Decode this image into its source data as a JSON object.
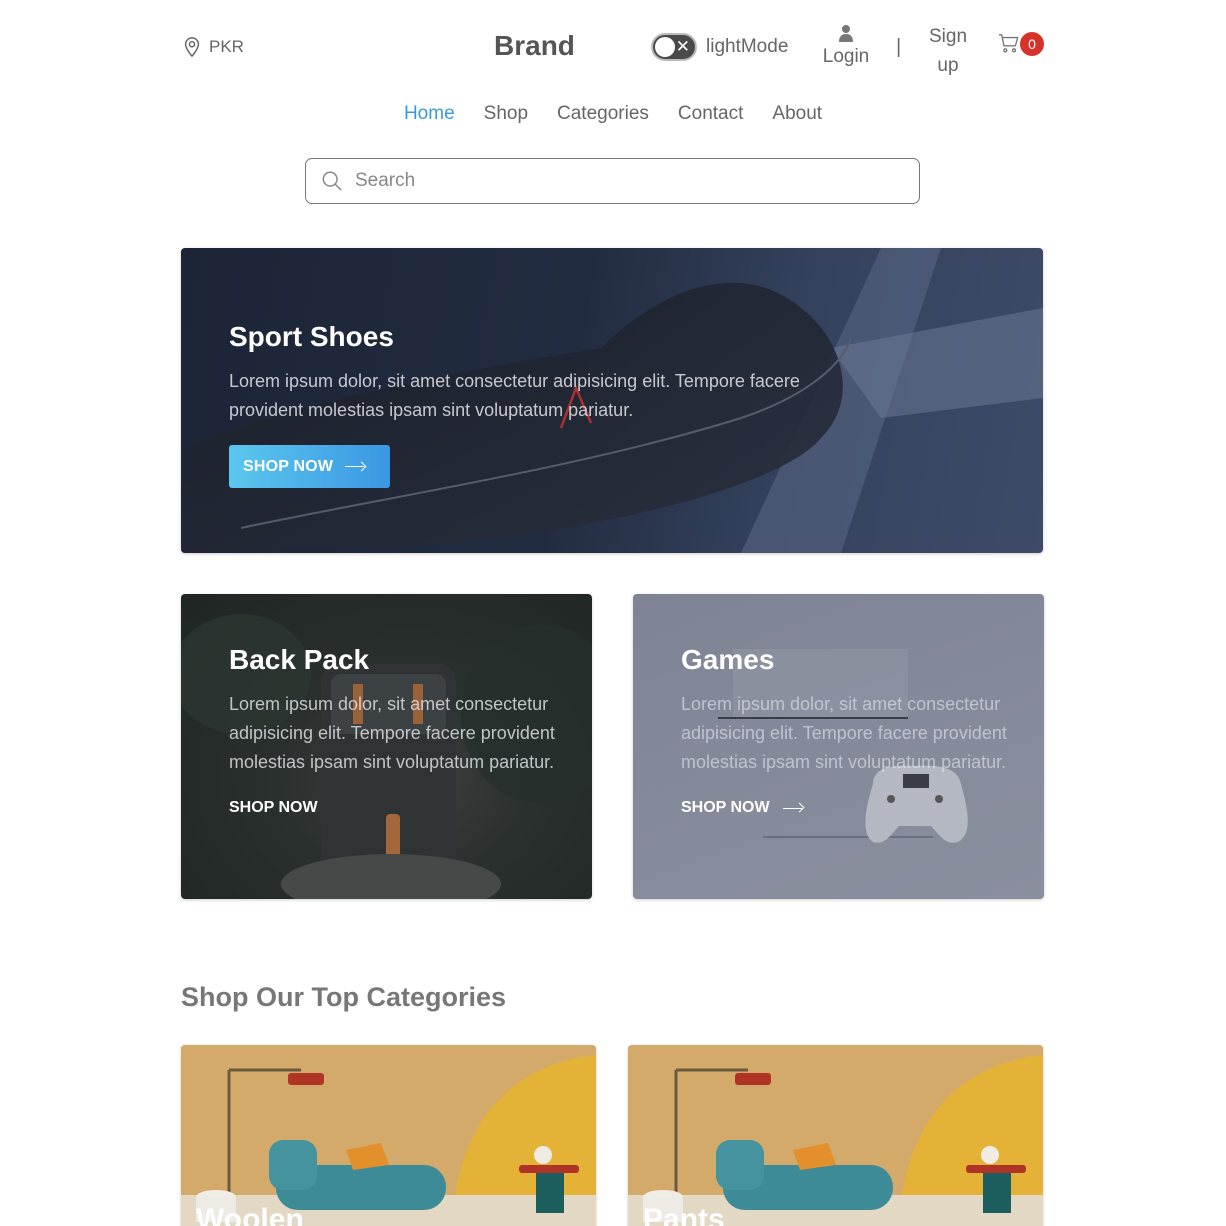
{
  "header": {
    "currency": "PKR",
    "currency_icon": "map-pin-icon",
    "brand": "Brand",
    "mode_label": "lightMode",
    "login_label": "Login",
    "divider": "|",
    "signup_label": "Sign up",
    "cart_count": "0",
    "cart_icon": "cart-icon",
    "user_icon": "user-icon",
    "badge_color": "#d6322a"
  },
  "nav": {
    "items": [
      "Home",
      "Shop",
      "Categories",
      "Contact",
      "About"
    ],
    "active": "Home",
    "active_color": "#3a9ad9"
  },
  "search": {
    "placeholder": "Search",
    "icon": "search-icon"
  },
  "banners": {
    "main": {
      "title": "Sport Shoes",
      "text": "Lorem ipsum dolor, sit amet consectetur adipisicing elit. Tempore facere provident molestias ipsam sint voluptatum pariatur.",
      "button": "SHOP NOW"
    },
    "backpack": {
      "title": "Back Pack",
      "text": "Lorem ipsum dolor, sit amet consectetur adipisicing elit. Tempore facere provident molestias ipsam sint voluptatum pariatur.",
      "link": "SHOP NOW"
    },
    "games": {
      "title": "Games",
      "text": "Lorem ipsum dolor, sit amet consectetur adipisicing elit. Tempore facere provident molestias ipsam sint voluptatum pariatur.",
      "link": "SHOP NOW"
    }
  },
  "categories": {
    "title": "Shop Our Top Categories",
    "items": [
      {
        "label": "Woolen"
      },
      {
        "label": "Pants"
      }
    ]
  }
}
